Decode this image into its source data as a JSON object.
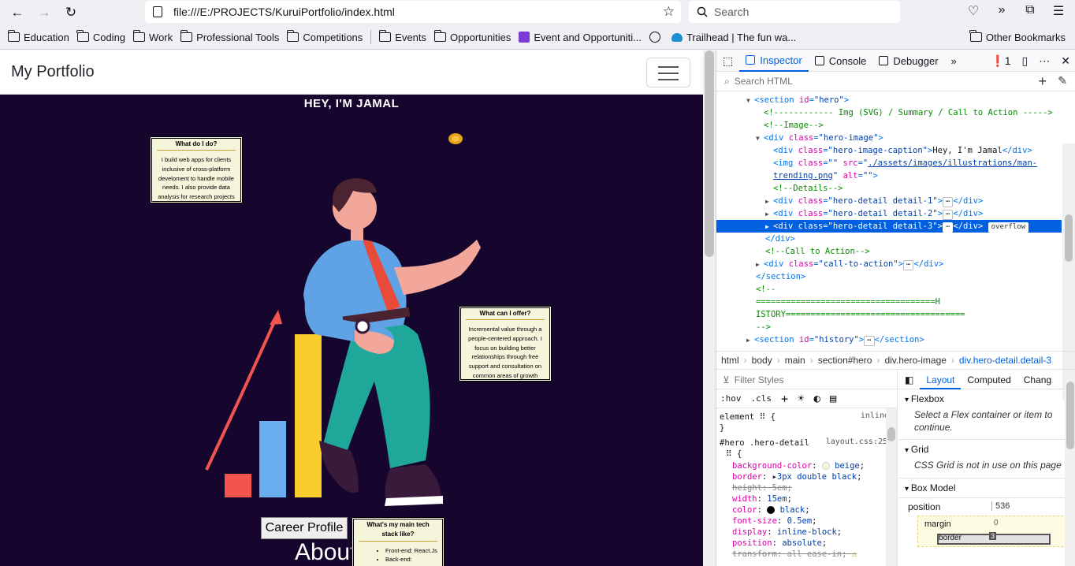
{
  "toolbar": {
    "url": "file:///E:/PROJECTS/KuruiPortfolio/index.html",
    "search_placeholder": "Search"
  },
  "bookmarks": {
    "items": [
      "Education",
      "Coding",
      "Work",
      "Professional Tools",
      "Competitions"
    ],
    "items2": [
      "Events",
      "Opportunities"
    ],
    "event_link": "Event and Opportuniti...",
    "trailhead": "Trailhead | The fun wa...",
    "other": "Other Bookmarks"
  },
  "page": {
    "brand": "My Portfolio",
    "hero_caption": "HEY, I'M JAMAL",
    "detail1": {
      "title": "What do I do?",
      "body": "I build web apps for clients inclusive of cross-platform develoment to handle mobile needs. I also provide data analysis for research projects"
    },
    "detail2": {
      "title": "What can I offer?",
      "body": "Incremental value through a people-centered approach. I focus on building better relationships through free support and consultation on common areas of growth"
    },
    "detail3": {
      "title": "What's my main tech stack like?",
      "items": [
        "Front-end: React.Js",
        "Back-end:"
      ]
    },
    "career_button": "Career Profile",
    "about_heading": "About",
    "colors": {
      "background": "#16062d",
      "detail_bg": "beige"
    }
  },
  "devtools": {
    "tabs": [
      "Inspector",
      "Console",
      "Debugger"
    ],
    "error_count": "1",
    "search_placeholder": "Search HTML",
    "breadcrumbs": [
      "html",
      "body",
      "main",
      "section#hero",
      "div.hero-image",
      "div.hero-detail.detail-3"
    ],
    "filter_placeholder": "Filter Styles",
    "rules_tools": [
      ":hov",
      ".cls"
    ],
    "rules": {
      "element_selector": "element",
      "element_origin": "inline",
      "selector": "#hero .hero-detail",
      "source": "layout.css:25",
      "decls": [
        {
          "prop": "background-color",
          "value": "beige"
        },
        {
          "prop": "border",
          "value": "3px double black"
        },
        {
          "prop": "height",
          "value": "5em"
        },
        {
          "prop": "width",
          "value": "15em"
        },
        {
          "prop": "color",
          "value": "black"
        },
        {
          "prop": "font-size",
          "value": "0.5em"
        },
        {
          "prop": "display",
          "value": "inline-block"
        },
        {
          "prop": "position",
          "value": "absolute"
        },
        {
          "prop": "transform",
          "value": "all ease-in"
        }
      ]
    },
    "layout_tabs": [
      "Layout",
      "Computed",
      "Chang"
    ],
    "flexbox_title": "Flexbox",
    "flexbox_msg": "Select a Flex container or item to continue.",
    "grid_title": "Grid",
    "grid_msg": "CSS Grid is not in use on this page",
    "boxmodel_title": "Box Model",
    "position_label": "position",
    "position_value": "536",
    "margin_label": "margin",
    "margin_value": "0",
    "border_label": "border",
    "border_value": "3"
  }
}
